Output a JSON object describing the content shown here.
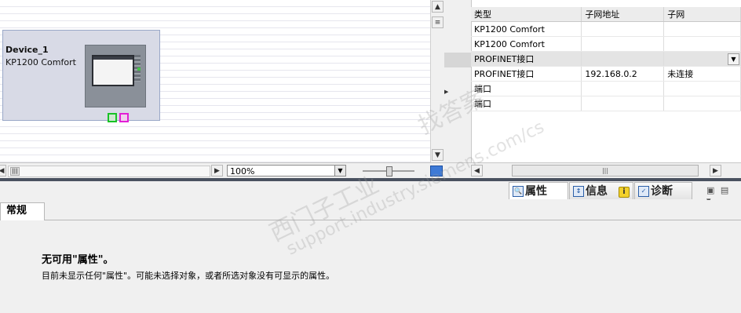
{
  "device": {
    "name": "Device_1",
    "type": "KP1200 Comfort"
  },
  "canvas_toolbar": {
    "zoom": "100%"
  },
  "table": {
    "headers": [
      "类型",
      "子网地址",
      "子网"
    ],
    "rows": [
      {
        "type": "KP1200 Comfort",
        "subnet_address": "",
        "subnet": ""
      },
      {
        "type": "KP1200 Comfort",
        "subnet_address": "",
        "subnet": ""
      },
      {
        "type": "PROFINET接口",
        "subnet_address": "",
        "subnet": ""
      },
      {
        "type": "PROFINET接口",
        "subnet_address": "192.168.0.2",
        "subnet": "未连接"
      },
      {
        "type": "端口",
        "subnet_address": "",
        "subnet": ""
      },
      {
        "type": "端口",
        "subnet_address": "",
        "subnet": ""
      }
    ]
  },
  "inspector_tabs": {
    "properties": "属性",
    "info": "信息",
    "diagnostics": "诊断",
    "info_badge": "i"
  },
  "properties": {
    "subtab": "常规",
    "no_props_title": "无可用\"属性\"。",
    "no_props_desc": "目前未显示任何\"属性\"。可能未选择对象，或者所选对象没有可显示的属性。"
  },
  "watermark": {
    "line1": "西门子工业",
    "line2": "support.industry.siemens.com/cs",
    "line3": "找答案"
  }
}
